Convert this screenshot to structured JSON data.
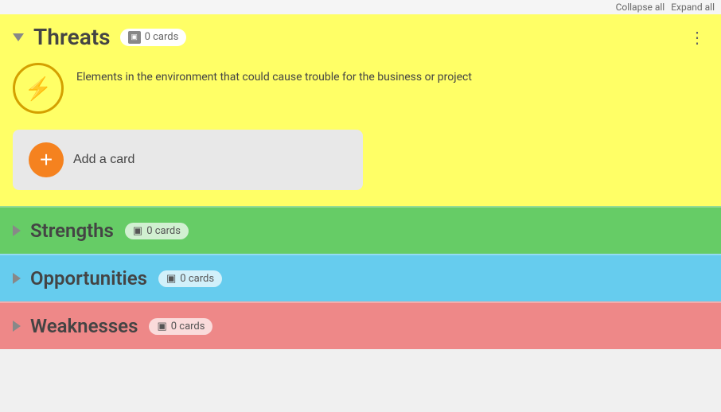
{
  "topBar": {
    "collapseAll": "Collapse all",
    "expandAll": "Expand all"
  },
  "threats": {
    "title": "Threats",
    "cardCount": "0 cards",
    "description": "Elements in the environment that could cause trouble for the business or project",
    "addCardLabel": "Add a card",
    "moreOptions": "⋮",
    "iconLabel": "lightning-bolt",
    "expanded": true
  },
  "strengths": {
    "title": "Strengths",
    "cardCount": "0 cards"
  },
  "opportunities": {
    "title": "Opportunities",
    "cardCount": "0 cards"
  },
  "weaknesses": {
    "title": "Weaknesses",
    "cardCount": "0 cards"
  }
}
